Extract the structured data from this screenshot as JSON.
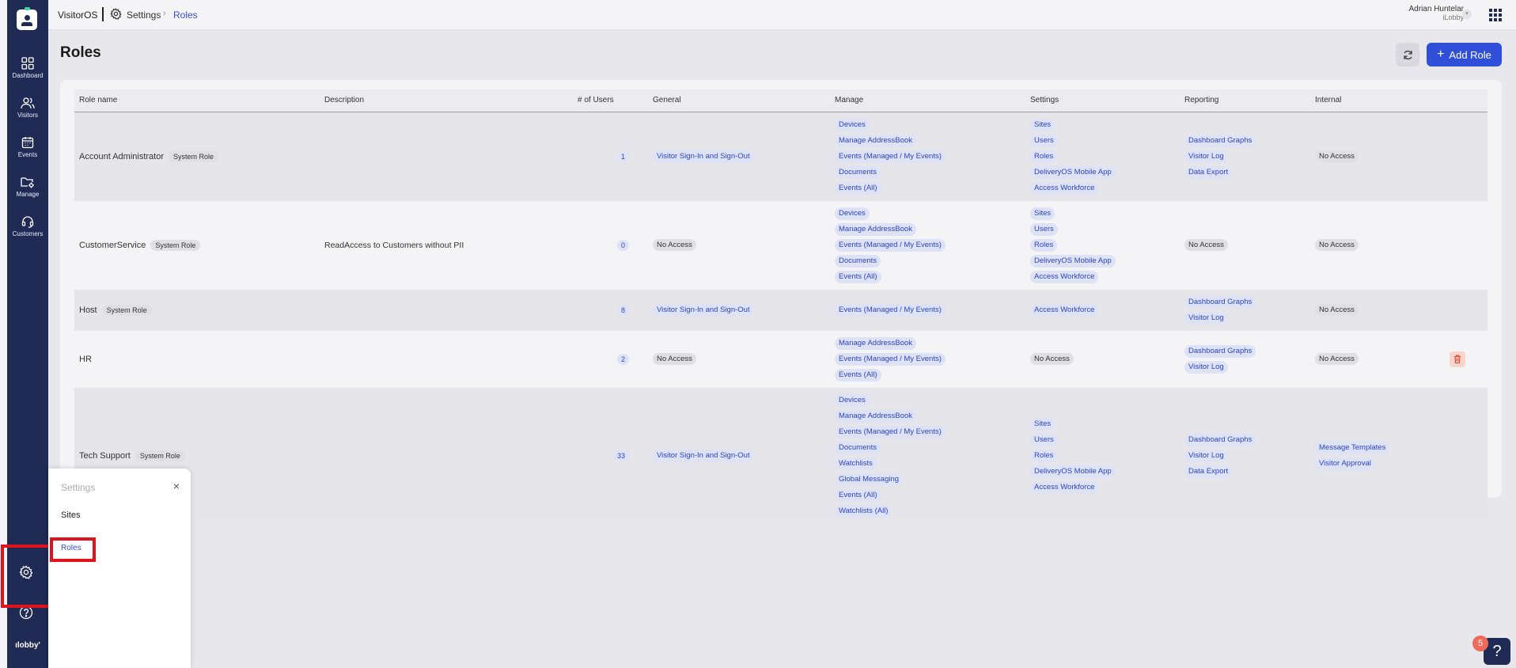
{
  "app": {
    "name": "VisitorOS"
  },
  "breadcrumb": {
    "section": "Settings",
    "current": "Roles"
  },
  "user": {
    "name": "Adrian Huntelar",
    "org": "iLobby"
  },
  "sidebar": {
    "items": [
      {
        "label": "Dashboard",
        "icon": "dashboard-icon"
      },
      {
        "label": "Visitors",
        "icon": "visitors-icon"
      },
      {
        "label": "Events",
        "icon": "calendar-icon"
      },
      {
        "label": "Manage",
        "icon": "folder-settings-icon"
      },
      {
        "label": "Customers",
        "icon": "headset-icon"
      }
    ],
    "brand": "ılobby'"
  },
  "page": {
    "title": "Roles",
    "add_label": "Add Role"
  },
  "table": {
    "headers": [
      "Role name",
      "Description",
      "# of Users",
      "General",
      "Manage",
      "Settings",
      "Reporting",
      "Internal"
    ],
    "rows": [
      {
        "name": "Account Administrator",
        "badge": "System Role",
        "description": "",
        "users": "1",
        "general": [
          "Visitor Sign-In and Sign-Out"
        ],
        "manage": [
          "Devices",
          "Manage AddressBook",
          "Events (Managed / My Events)",
          "Documents",
          "Events (All)"
        ],
        "settings": [
          "Sites",
          "Users",
          "Roles",
          "DeliveryOS Mobile App",
          "Access Workforce"
        ],
        "reporting": [
          "Dashboard Graphs",
          "Visitor Log",
          "Data Export"
        ],
        "internal": "No Access"
      },
      {
        "name": "CustomerService",
        "badge": "System Role",
        "description": "ReadAccess to Customers without PII",
        "users": "0",
        "general_noaccess": "No Access",
        "manage": [
          "Devices",
          "Manage AddressBook",
          "Events (Managed / My Events)",
          "Documents",
          "Events (All)"
        ],
        "settings": [
          "Sites",
          "Users",
          "Roles",
          "DeliveryOS Mobile App",
          "Access Workforce"
        ],
        "reporting_noaccess": "No Access",
        "internal": "No Access"
      },
      {
        "name": "Host",
        "badge": "System Role",
        "description": "",
        "users": "8",
        "general": [
          "Visitor Sign-In and Sign-Out"
        ],
        "manage": [
          "Events (Managed / My Events)"
        ],
        "settings": [
          "Access Workforce"
        ],
        "reporting": [
          "Dashboard Graphs",
          "Visitor Log"
        ],
        "internal": "No Access"
      },
      {
        "name": "HR",
        "badge": "",
        "description": "",
        "users": "2",
        "general_noaccess": "No Access",
        "manage": [
          "Manage AddressBook",
          "Events (Managed / My Events)",
          "Events (All)"
        ],
        "settings_noaccess": "No Access",
        "reporting": [
          "Dashboard Graphs",
          "Visitor Log"
        ],
        "internal": "No Access"
      },
      {
        "name": "Tech Support",
        "badge": "System Role",
        "description": "",
        "users": "33",
        "general": [
          "Visitor Sign-In and Sign-Out"
        ],
        "manage": [
          "Devices",
          "Manage AddressBook",
          "Events (Managed / My Events)",
          "Documents",
          "Watchlists",
          "Global Messaging",
          "Events (All)",
          "Watchlists (All)"
        ],
        "settings": [
          "Sites",
          "Users",
          "Roles",
          "DeliveryOS Mobile App",
          "Access Workforce"
        ],
        "reporting": [
          "Dashboard Graphs",
          "Visitor Log",
          "Data Export"
        ],
        "internal_list": [
          "Message Templates",
          "Visitor Approval"
        ]
      }
    ]
  },
  "popover": {
    "title": "Settings",
    "items": [
      "Sites",
      "Roles"
    ]
  },
  "help": {
    "badge": "5",
    "label": "?"
  },
  "colors": {
    "sidebar": "#1f2a55",
    "accent": "#2f4fd8",
    "highlight": "#e0121b",
    "tag_bg": "#dde2f5",
    "tag_text": "#2e45c0"
  }
}
